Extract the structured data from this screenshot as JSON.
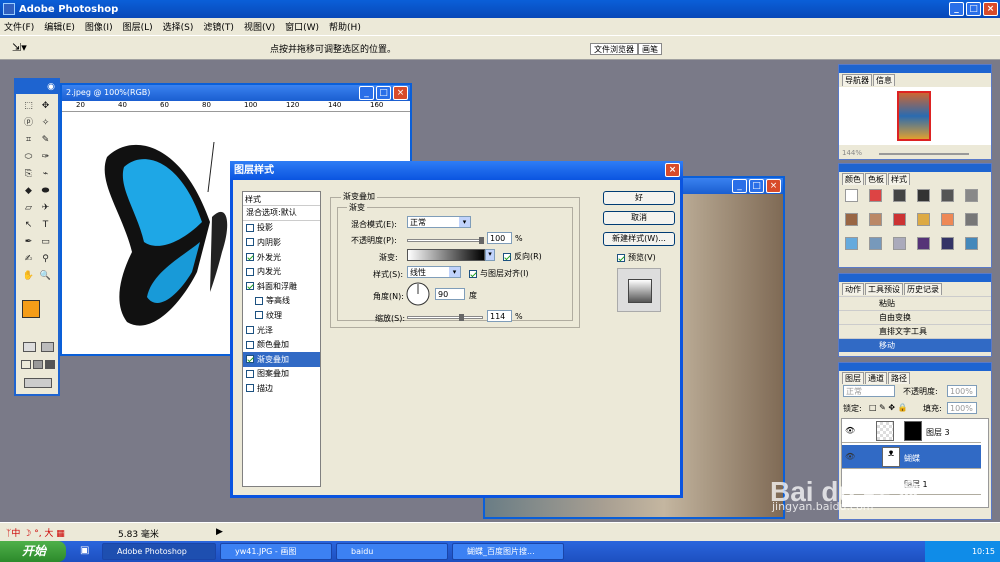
{
  "app": {
    "title": "Adobe Photoshop"
  },
  "menu": [
    "文件(F)",
    "编辑(E)",
    "图像(I)",
    "图层(L)",
    "选择(S)",
    "滤镜(T)",
    "视图(V)",
    "窗口(W)",
    "帮助(H)"
  ],
  "options": {
    "hint": "点按并拖移可调整选区的位置。",
    "tabs": [
      "文件浏览器",
      "画笔"
    ]
  },
  "doc1": {
    "title": "2.jpeg @ 100%(RGB)",
    "ruler": [
      "20",
      "40",
      "60",
      "80",
      "100",
      "120",
      "140",
      "160"
    ]
  },
  "navigator": {
    "tabs": [
      "导航器",
      "信息"
    ],
    "zoom": "144%"
  },
  "swatches": {
    "tabs": [
      "颜色",
      "色板",
      "样式"
    ]
  },
  "actions": {
    "tabs": [
      "动作",
      "工具预设",
      "历史记录"
    ],
    "items": [
      "粘贴",
      "自由变换",
      "直排文字工具",
      "移动"
    ]
  },
  "layers": {
    "tabs": [
      "图层",
      "通道",
      "路径"
    ],
    "blend": "正常",
    "opacity_label": "不透明度:",
    "opacity": "100%",
    "lock_label": "锁定:",
    "fill_label": "填充:",
    "fill": "100%",
    "rows": [
      "图层 3",
      "蝴蝶",
      "图层 1"
    ]
  },
  "dialog": {
    "title": "图层样式",
    "styles_header": "样式",
    "blend_default": "混合选项:默认",
    "effects": [
      {
        "label": "投影",
        "checked": false,
        "sub": false
      },
      {
        "label": "内阴影",
        "checked": false,
        "sub": false
      },
      {
        "label": "外发光",
        "checked": true,
        "sub": false
      },
      {
        "label": "内发光",
        "checked": false,
        "sub": false
      },
      {
        "label": "斜面和浮雕",
        "checked": true,
        "sub": false
      },
      {
        "label": "等高线",
        "checked": false,
        "sub": true
      },
      {
        "label": "纹理",
        "checked": false,
        "sub": true
      },
      {
        "label": "光泽",
        "checked": false,
        "sub": false
      },
      {
        "label": "颜色叠加",
        "checked": false,
        "sub": false
      },
      {
        "label": "渐变叠加",
        "checked": true,
        "sub": false,
        "selected": true
      },
      {
        "label": "图案叠加",
        "checked": false,
        "sub": false
      },
      {
        "label": "描边",
        "checked": false,
        "sub": false
      }
    ],
    "group_title": "渐变叠加",
    "sub_title": "渐变",
    "blend_label": "混合模式(E):",
    "blend_value": "正常",
    "opacity_label": "不透明度(P):",
    "opacity_value": "100",
    "gradient_label": "渐变:",
    "reverse_label": "反向(R)",
    "style_label": "样式(S):",
    "style_value": "线性",
    "align_label": "与图层对齐(I)",
    "angle_label": "角度(N):",
    "angle_value": "90",
    "angle_unit": "度",
    "scale_label": "缩放(S):",
    "scale_value": "114",
    "percent": "%",
    "ok": "好",
    "cancel": "取消",
    "new_style": "新建样式(W)...",
    "preview": "预览(V)"
  },
  "status": {
    "value": "5.83 毫米",
    "ime": "中"
  },
  "taskbar": {
    "start": "开始",
    "tasks": [
      "Adobe Photoshop",
      "yw41.JPG - 画图",
      "baidu",
      "蝴蝶_百度图片搜..."
    ],
    "time": "10:15"
  },
  "watermark": {
    "brand": "Bai du 经验",
    "url": "jingyan.baidu.com"
  },
  "colors": {
    "fg": "#f59d18",
    "bg": "#ffffff",
    "accent": "#0a5fd8"
  }
}
